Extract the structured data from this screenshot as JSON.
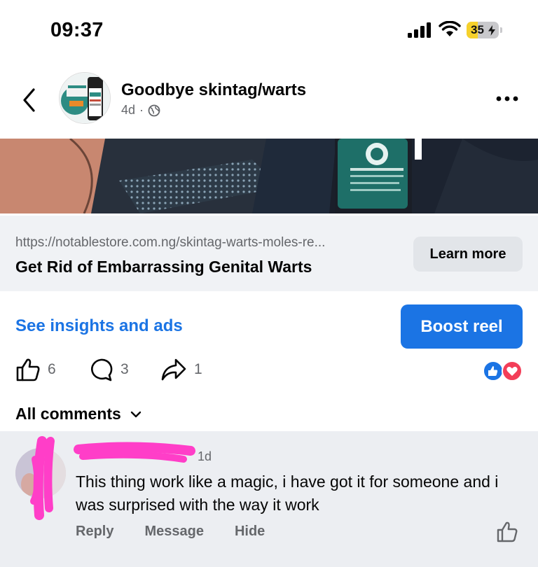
{
  "status_bar": {
    "time": "09:37",
    "battery": "35",
    "battery_level": 0.35,
    "icons": [
      "signal-icon",
      "wifi-icon",
      "battery-icon"
    ]
  },
  "post": {
    "page_name": "Goodbye skintag/warts",
    "age": "4d",
    "separator": "·",
    "icons": [
      "back-chevron-icon",
      "globe-icon",
      "more-dots-icon"
    ]
  },
  "link_card": {
    "url": "https://notablestore.com.ng/skintag-warts-moles-re...",
    "title": "Get Rid of Embarrassing Genital Warts",
    "cta": "Learn more"
  },
  "actions": {
    "insights": "See insights and ads",
    "boost": "Boost reel"
  },
  "engagement": {
    "likes": "6",
    "comments": "3",
    "shares": "1",
    "icons": [
      "thumbs-up-icon",
      "comment-bubble-icon",
      "share-arrow-icon",
      "like-reaction-icon",
      "love-reaction-icon"
    ]
  },
  "comments_section": {
    "filter_label": "All comments",
    "icon": "chevron-down-icon"
  },
  "comment": {
    "time": "1d",
    "text": "This thing work like a magic, i have got it for someone and i was surprised with the way it work",
    "actions": {
      "reply": "Reply",
      "message": "Message",
      "hide": "Hide"
    }
  },
  "colors": {
    "accent": "#1b74e4",
    "secondary_text": "#65676b",
    "card_background": "#f0f2f5",
    "comment_background": "#eceef2",
    "scribble": "#ff3ec8"
  }
}
